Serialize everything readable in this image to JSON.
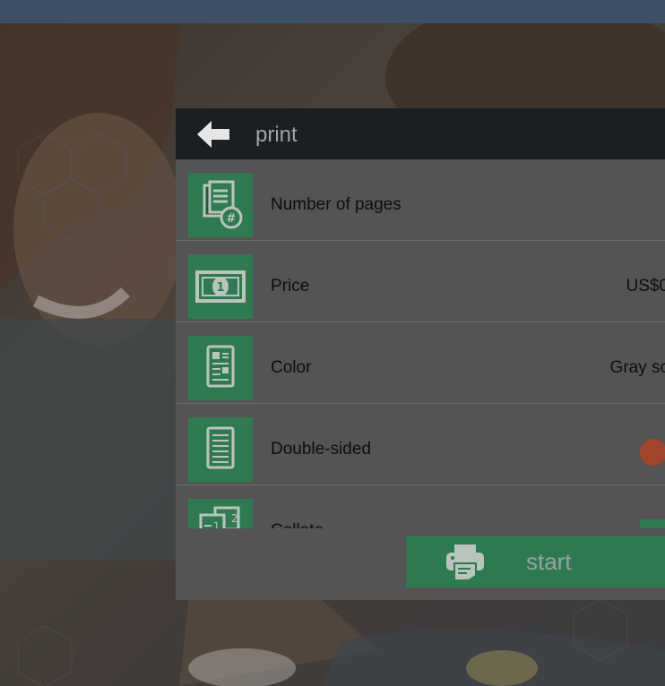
{
  "dialog": {
    "title": "print",
    "rows": [
      {
        "label": "Number of pages",
        "value": "",
        "icon": "pages-count-icon"
      },
      {
        "label": "Price",
        "value": "US$0",
        "icon": "banknote-icon"
      },
      {
        "label": "Color",
        "value": "Gray sc",
        "icon": "document-layout-icon"
      },
      {
        "label": "Double-sided",
        "value": "",
        "icon": "document-lines-icon",
        "control": "toggle-off"
      },
      {
        "label": "Collate",
        "value": "",
        "icon": "collate-pages-icon",
        "control": "toggle-on"
      }
    ],
    "start_label": "start"
  },
  "colors": {
    "header": "#1c1f22",
    "tile": "#2f7a50",
    "toggle_off": "#a1452c",
    "topbar": "#3e4f68"
  }
}
